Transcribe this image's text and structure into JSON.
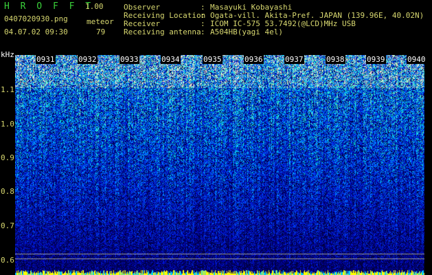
{
  "app": {
    "title": "H R O F F T",
    "version": "1.00"
  },
  "file": {
    "name": "0407020930.png",
    "datetime": "04.07.02 09:30"
  },
  "meteor": {
    "label": "meteor",
    "count": "79"
  },
  "info": [
    {
      "label": "Observer",
      "value": "Masayuki Kobayashi"
    },
    {
      "label": "Receiving Location",
      "value": "Ogata-vill. Akita-Pref. JAPAN (139.96E, 40.02N)"
    },
    {
      "label": "Receiver",
      "value": "ICOM IC-575 53.7492(@LCD)MHz USB"
    },
    {
      "label": "Receiving antenna",
      "value": "A504HB(yagi 4el)"
    }
  ],
  "separator": ":",
  "yaxis": {
    "unit": "kHz",
    "ticks": [
      "1.1",
      "1.0",
      "0.9",
      "0.8",
      "0.7",
      "0.6"
    ]
  },
  "xaxis": {
    "ticks": [
      "0931",
      "0932",
      "0933",
      "0934",
      "0935",
      "0936",
      "0937",
      "0938",
      "0939",
      "0940"
    ]
  },
  "colors": {
    "background": "#000000",
    "text": "#d8d870",
    "title": "#3ad13a",
    "signal": "#00e0ff",
    "meteor_trace": "#ffff00"
  }
}
